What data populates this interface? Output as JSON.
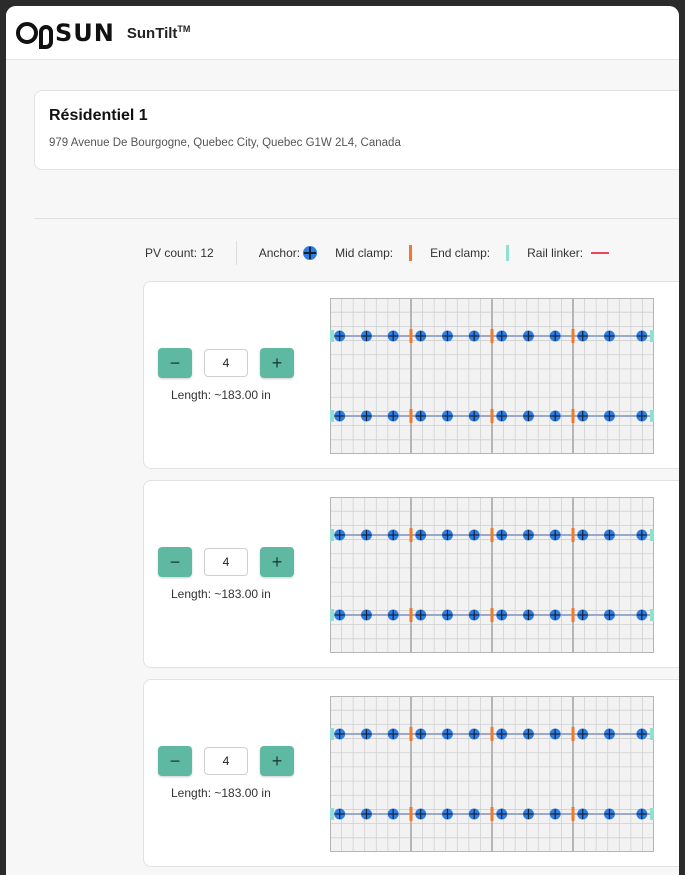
{
  "header": {
    "logo": "SUN",
    "app_name": "SunTilt",
    "trademark": "TM"
  },
  "site": {
    "name": "Résidentiel 1",
    "address": "979 Avenue De Bourgogne, Quebec City, Quebec G1W 2L4, Canada"
  },
  "legend": {
    "pv_count": "PV count: 12",
    "anchor_label": "Anchor:",
    "mid_clamp_label": "Mid clamp:",
    "end_clamp_label": "End clamp:",
    "rail_linker_label": "Rail linker:"
  },
  "colors": {
    "accent": "#5fb8a2",
    "anchor": "#2f7de1",
    "mid_clamp": "#f07a2a",
    "end_clamp": "#8fe0d0",
    "rail_linker": "#ee4460"
  },
  "rows": [
    {
      "minus": "−",
      "plus": "+",
      "count": "4",
      "length": "Length: ~183.00 in"
    },
    {
      "minus": "−",
      "plus": "+",
      "count": "4",
      "length": "Length: ~183.00 in"
    },
    {
      "minus": "−",
      "plus": "+",
      "count": "4",
      "length": "Length: ~183.00 in"
    }
  ]
}
